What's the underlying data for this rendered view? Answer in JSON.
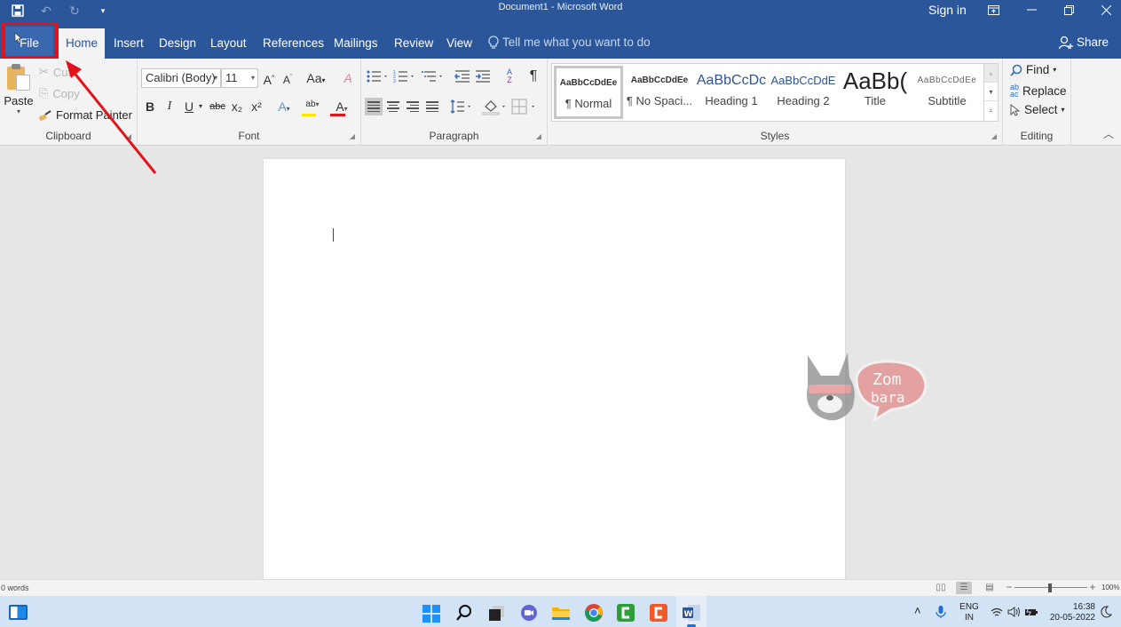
{
  "window": {
    "title": "Document1  -  Microsoft Word",
    "sign_in": "Sign in",
    "controls": {
      "ribbon_display": "⊡",
      "minimize": "—",
      "restore": "❐",
      "close": "✕"
    }
  },
  "quick_access": {
    "save_icon": "💾",
    "undo_icon": "↶",
    "redo_icon": "↻",
    "customize_icon": "▾"
  },
  "tabs": [
    {
      "label": "File"
    },
    {
      "label": "Home",
      "active": true
    },
    {
      "label": "Insert"
    },
    {
      "label": "Design"
    },
    {
      "label": "Layout"
    },
    {
      "label": "References"
    },
    {
      "label": "Mailings"
    },
    {
      "label": "Review"
    },
    {
      "label": "View"
    }
  ],
  "tell_me": {
    "placeholder": "Tell me what you want to do",
    "icon": "💡"
  },
  "share": {
    "label": "Share",
    "icon": "👤"
  },
  "clipboard": {
    "label": "Clipboard",
    "paste": "Paste",
    "paste_arrow": "▾",
    "cut": "Cut",
    "copy": "Copy",
    "format_painter": "Format Painter",
    "cut_icon": "✂",
    "copy_icon": "⎘",
    "painter_icon": "🖌"
  },
  "font": {
    "label": "Font",
    "font_name": "Calibri (Body)",
    "font_size": "11",
    "grow": "A˄",
    "shrink": "A˅",
    "change_case": "Aa",
    "clear_format": "A",
    "bold": "B",
    "italic": "I",
    "underline": "U",
    "strikethrough": "abc",
    "subscript": "x₂",
    "superscript": "x²",
    "text_effects": "A",
    "highlight": "ab",
    "font_color": "A",
    "highlight_color": "#ffe600",
    "font_color_value": "#e0141a"
  },
  "paragraph": {
    "label": "Paragraph",
    "sort": "A↓Z",
    "show_marks": "¶"
  },
  "styles": {
    "label": "Styles",
    "items": [
      {
        "sample": "AaBbCcDdEe",
        "name": "¶ Normal",
        "selected": true
      },
      {
        "sample": "AaBbCcDdEe",
        "name": "¶ No Spaci..."
      },
      {
        "sample": "AaBbCcDc",
        "name": "Heading 1"
      },
      {
        "sample": "AaBbCcDdE",
        "name": "Heading 2"
      },
      {
        "sample": "AaBb(",
        "name": "Title"
      },
      {
        "sample": "AaBbCcDdEe",
        "name": "Subtitle"
      }
    ]
  },
  "editing": {
    "label": "Editing",
    "find": "Find",
    "replace": "Replace",
    "select": "Select",
    "find_icon": "⚲",
    "replace_icon": "ab",
    "select_icon": "⇱"
  },
  "watermark": {
    "line1": "Zom",
    "line2": "bara"
  },
  "status": {
    "words": "0 words",
    "zoom_minus": "−",
    "zoom_plus": "+",
    "zoom_level": "100%"
  },
  "taskbar": {
    "lang_line1": "ENG",
    "lang_line2": "IN",
    "time": "16:38",
    "date": "20-05-2022",
    "tray_up": "˄"
  }
}
